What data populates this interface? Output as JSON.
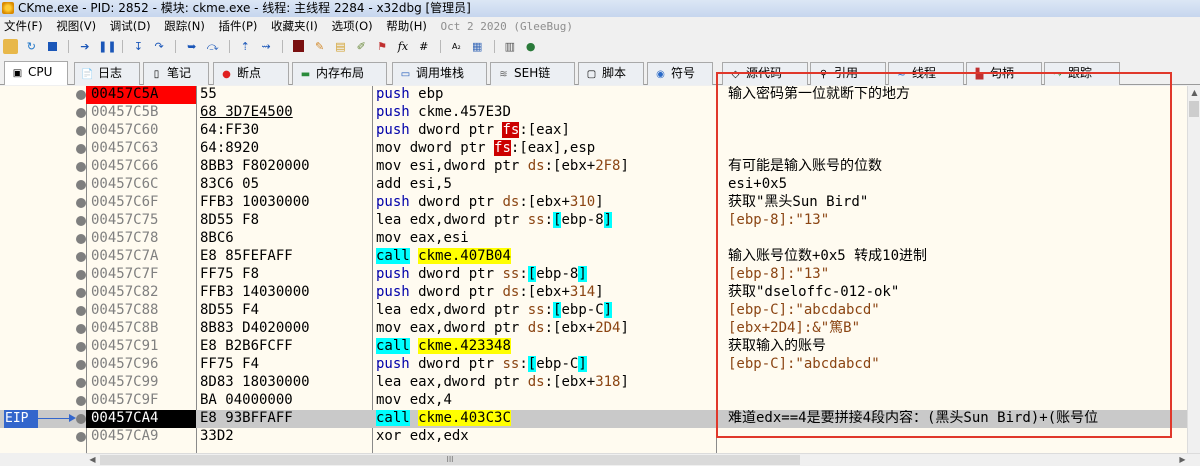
{
  "window": {
    "title": "CKme.exe - PID: 2852 - 模块: ckme.exe - 线程: 主线程 2284 - x32dbg [管理员]"
  },
  "menu": [
    "文件(F)",
    "视图(V)",
    "调试(D)",
    "跟踪(N)",
    "插件(P)",
    "收藏夹(I)",
    "选项(O)",
    "帮助(H)"
  ],
  "build_date": "Oct 2 2020 (GleeBug)",
  "toolbar_icons": [
    "open-icon",
    "restart-icon",
    "stop-icon",
    "run-icon",
    "pause-icon",
    "step-into-icon",
    "step-over-icon",
    "trace-into-icon",
    "trace-over-icon",
    "execute-till-return-icon",
    "run-to-user-code-icon",
    "scylla-icon",
    "patch-icon",
    "comments-icon",
    "labels-icon",
    "bookmarks-icon",
    "functions-icon",
    "variables-icon",
    "calculator-icon",
    "strings-icon",
    "help-icon"
  ],
  "toolbar_glyphs": {
    "fx": "fx",
    "hash": "#",
    "az": "A₂"
  },
  "tabs": [
    {
      "icon": "cpu-icon",
      "label": "CPU"
    },
    {
      "icon": "log-icon",
      "label": "日志"
    },
    {
      "icon": "notes-icon",
      "label": "笔记"
    },
    {
      "icon": "breakpoint-icon",
      "label": "断点"
    },
    {
      "icon": "memory-map-icon",
      "label": "内存布局"
    },
    {
      "icon": "call-stack-icon",
      "label": "调用堆栈"
    },
    {
      "icon": "seh-icon",
      "label": "SEH链"
    },
    {
      "icon": "script-icon",
      "label": "脚本"
    },
    {
      "icon": "symbols-icon",
      "label": "符号"
    },
    {
      "icon": "source-icon",
      "label": "源代码"
    },
    {
      "icon": "references-icon",
      "label": "引用"
    },
    {
      "icon": "threads-icon",
      "label": "线程"
    },
    {
      "icon": "handles-icon",
      "label": "句柄"
    },
    {
      "icon": "trace-icon",
      "label": "跟踪"
    }
  ],
  "eip_label": "EIP",
  "rows": [
    {
      "addr": "00457C5A",
      "bytes": "55",
      "mn": "push",
      "ops": [
        [
          "t",
          "ebp"
        ]
      ],
      "comment": "输入密码第一位就断下的地方",
      "bp": true
    },
    {
      "addr": "00457C5B",
      "bytes": "68 3D7E4500",
      "mn": "push",
      "ops": [
        [
          "t",
          "ckme.457E3D"
        ]
      ],
      "comment": "",
      "under": true
    },
    {
      "addr": "00457C60",
      "bytes": "64:FF30",
      "mn": "push",
      "ops": [
        [
          "t",
          "dword ptr "
        ],
        [
          "fs",
          "fs"
        ],
        [
          "t",
          ":[eax]"
        ]
      ],
      "comment": ""
    },
    {
      "addr": "00457C63",
      "bytes": "64:8920",
      "mn": "mov",
      "ops": [
        [
          "t",
          "dword ptr "
        ],
        [
          "fs",
          "fs"
        ],
        [
          "t",
          ":[eax],esp"
        ]
      ],
      "comment": ""
    },
    {
      "addr": "00457C66",
      "bytes": "8BB3 F8020000",
      "mn": "mov",
      "ops": [
        [
          "t",
          "esi,dword ptr "
        ],
        [
          "s",
          "ds"
        ],
        [
          "t",
          ":[ebx+"
        ],
        [
          "n",
          "2F8"
        ],
        [
          "t",
          "]"
        ]
      ],
      "comment": "有可能是输入账号的位数"
    },
    {
      "addr": "00457C6C",
      "bytes": "83C6 05",
      "mn": "add",
      "ops": [
        [
          "t",
          "esi,5"
        ]
      ],
      "comment": "esi+0x5"
    },
    {
      "addr": "00457C6F",
      "bytes": "FFB3 10030000",
      "mn": "push",
      "ops": [
        [
          "t",
          "dword ptr "
        ],
        [
          "s",
          "ds"
        ],
        [
          "t",
          ":[ebx+"
        ],
        [
          "n",
          "310"
        ],
        [
          "t",
          "]"
        ]
      ],
      "comment": "获取\"黑头Sun Bird\""
    },
    {
      "addr": "00457C75",
      "bytes": "8D55 F8",
      "mn": "lea",
      "ops": [
        [
          "t",
          "edx,dword ptr "
        ],
        [
          "s",
          "ss"
        ],
        [
          "t",
          ":"
        ],
        [
          "b",
          "["
        ],
        [
          "t",
          "ebp-8"
        ],
        [
          "b",
          "]"
        ]
      ],
      "comment": "[ebp-8]:\"13\"",
      "cstr": true
    },
    {
      "addr": "00457C78",
      "bytes": "8BC6",
      "mn": "mov",
      "ops": [
        [
          "t",
          "eax,esi"
        ]
      ],
      "comment": ""
    },
    {
      "addr": "00457C7A",
      "bytes": "E8 85FEFAFF",
      "mn": "call",
      "ops": [
        [
          "y",
          "ckme.407B04"
        ]
      ],
      "comment": "输入账号位数+0x5 转成10进制",
      "call": true
    },
    {
      "addr": "00457C7F",
      "bytes": "FF75 F8",
      "mn": "push",
      "ops": [
        [
          "t",
          "dword ptr "
        ],
        [
          "s",
          "ss"
        ],
        [
          "t",
          ":"
        ],
        [
          "b",
          "["
        ],
        [
          "t",
          "ebp-8"
        ],
        [
          "b",
          "]"
        ]
      ],
      "comment": "[ebp-8]:\"13\"",
      "cstr": true
    },
    {
      "addr": "00457C82",
      "bytes": "FFB3 14030000",
      "mn": "push",
      "ops": [
        [
          "t",
          "dword ptr "
        ],
        [
          "s",
          "ds"
        ],
        [
          "t",
          ":[ebx+"
        ],
        [
          "n",
          "314"
        ],
        [
          "t",
          "]"
        ]
      ],
      "comment": "获取\"dseloffc-012-ok\""
    },
    {
      "addr": "00457C88",
      "bytes": "8D55 F4",
      "mn": "lea",
      "ops": [
        [
          "t",
          "edx,dword ptr "
        ],
        [
          "s",
          "ss"
        ],
        [
          "t",
          ":"
        ],
        [
          "b",
          "["
        ],
        [
          "t",
          "ebp-C"
        ],
        [
          "b",
          "]"
        ]
      ],
      "comment": "[ebp-C]:\"abcdabcd\"",
      "cstr": true
    },
    {
      "addr": "00457C8B",
      "bytes": "8B83 D4020000",
      "mn": "mov",
      "ops": [
        [
          "t",
          "eax,dword ptr "
        ],
        [
          "s",
          "ds"
        ],
        [
          "t",
          ":[ebx+"
        ],
        [
          "n",
          "2D4"
        ],
        [
          "t",
          "]"
        ]
      ],
      "comment": "[ebx+2D4]:&\"篤B\"",
      "cstr": true
    },
    {
      "addr": "00457C91",
      "bytes": "E8 B2B6FCFF",
      "mn": "call",
      "ops": [
        [
          "y",
          "ckme.423348"
        ]
      ],
      "comment": "获取输入的账号",
      "call": true
    },
    {
      "addr": "00457C96",
      "bytes": "FF75 F4",
      "mn": "push",
      "ops": [
        [
          "t",
          "dword ptr "
        ],
        [
          "s",
          "ss"
        ],
        [
          "t",
          ":"
        ],
        [
          "b",
          "["
        ],
        [
          "t",
          "ebp-C"
        ],
        [
          "b",
          "]"
        ]
      ],
      "comment": "[ebp-C]:\"abcdabcd\"",
      "cstr": true
    },
    {
      "addr": "00457C99",
      "bytes": "8D83 18030000",
      "mn": "lea",
      "ops": [
        [
          "t",
          "eax,dword ptr "
        ],
        [
          "s",
          "ds"
        ],
        [
          "t",
          ":[ebx+"
        ],
        [
          "n",
          "318"
        ],
        [
          "t",
          "]"
        ]
      ],
      "comment": ""
    },
    {
      "addr": "00457C9F",
      "bytes": "BA 04000000",
      "mn": "mov",
      "ops": [
        [
          "t",
          "edx,4"
        ]
      ],
      "comment": ""
    },
    {
      "addr": "00457CA4",
      "bytes": "E8 93BFFAFF",
      "mn": "call",
      "ops": [
        [
          "y",
          "ckme.403C3C"
        ]
      ],
      "comment": "难道edx==4是要拼接4段内容：(黑头Sun Bird)+(账号位",
      "call": true,
      "eip": true
    },
    {
      "addr": "00457CA9",
      "bytes": "33D2",
      "mn": "xor",
      "ops": [
        [
          "t",
          "edx,edx"
        ]
      ],
      "comment": ""
    }
  ],
  "scroll": {
    "h_thumb_grip": "III"
  },
  "colors": {
    "breakpoint": "#ff0000",
    "call_bg": "#00ffff",
    "target_bg": "#ffff00",
    "annotation_box": "#e0382b",
    "eip_badge": "#3366cc"
  }
}
